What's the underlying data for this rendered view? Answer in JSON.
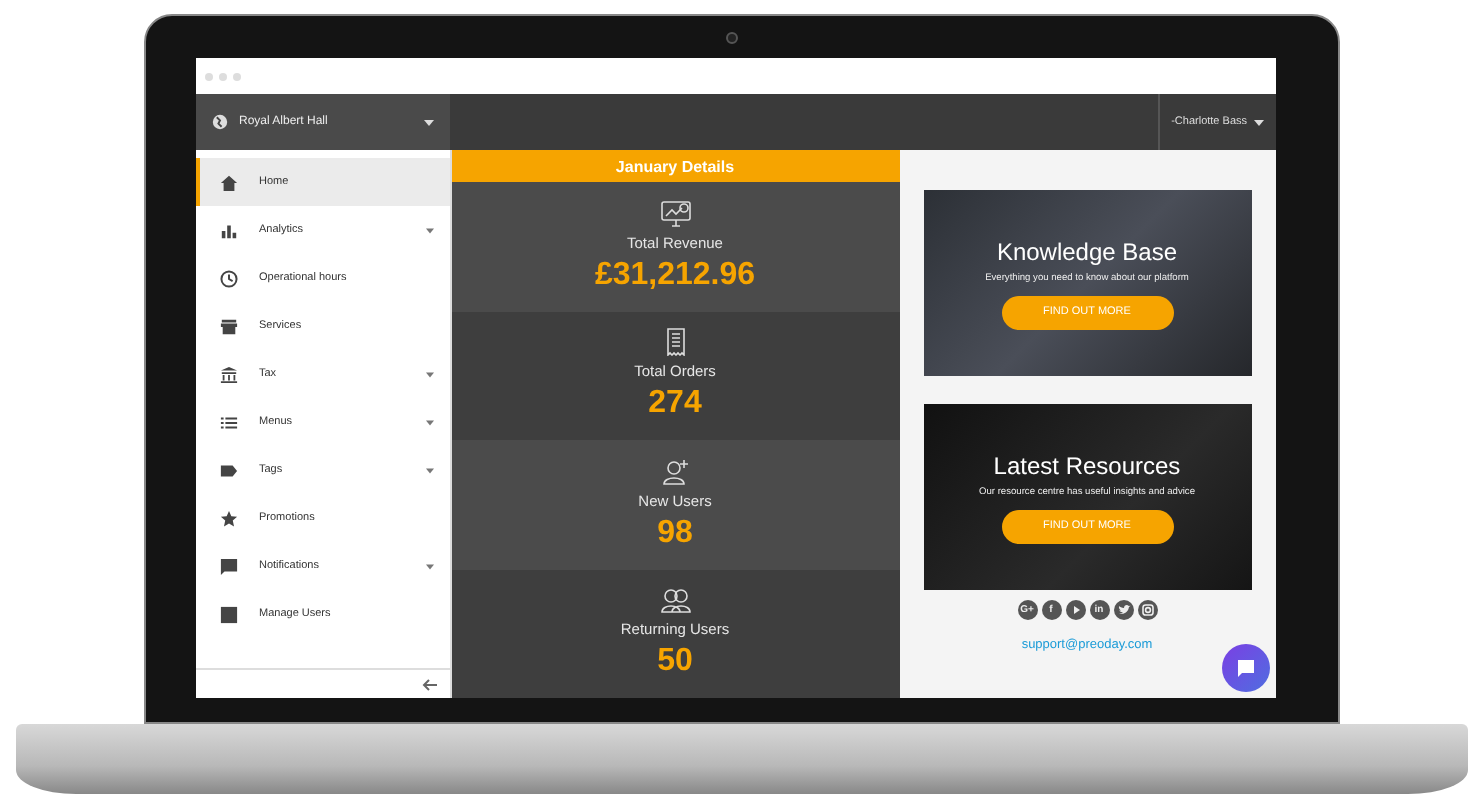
{
  "venue": {
    "name": "Royal Albert Hall"
  },
  "user": {
    "name": "-Charlotte Bass"
  },
  "sidebar": {
    "items": [
      {
        "label": "Home",
        "selected": true,
        "has_submenu": false
      },
      {
        "label": "Analytics",
        "selected": false,
        "has_submenu": true
      },
      {
        "label": "Operational hours",
        "selected": false,
        "has_submenu": false
      },
      {
        "label": "Services",
        "selected": false,
        "has_submenu": false
      },
      {
        "label": "Tax",
        "selected": false,
        "has_submenu": true
      },
      {
        "label": "Menus",
        "selected": false,
        "has_submenu": true
      },
      {
        "label": "Tags",
        "selected": false,
        "has_submenu": true
      },
      {
        "label": "Promotions",
        "selected": false,
        "has_submenu": false
      },
      {
        "label": "Notifications",
        "selected": false,
        "has_submenu": true
      },
      {
        "label": "Manage Users",
        "selected": false,
        "has_submenu": false
      }
    ]
  },
  "details": {
    "title": "January Details",
    "stats": [
      {
        "label": "Total Revenue",
        "value": "£31,212.96"
      },
      {
        "label": "Total Orders",
        "value": "274"
      },
      {
        "label": "New Users",
        "value": "98"
      },
      {
        "label": "Returning Users",
        "value": "50"
      }
    ]
  },
  "cards": [
    {
      "title": "Knowledge Base",
      "subtitle": "Everything you need to know about our platform",
      "button": "FIND OUT MORE"
    },
    {
      "title": "Latest Resources",
      "subtitle": "Our resource centre has useful insights and advice",
      "button": "FIND OUT MORE"
    }
  ],
  "social": [
    {
      "kind": "text",
      "label": "G+"
    },
    {
      "kind": "text",
      "label": "f"
    },
    {
      "kind": "play"
    },
    {
      "kind": "text",
      "label": "in"
    },
    {
      "kind": "bird"
    },
    {
      "kind": "camera"
    }
  ],
  "support_email": "support@preoday.com"
}
